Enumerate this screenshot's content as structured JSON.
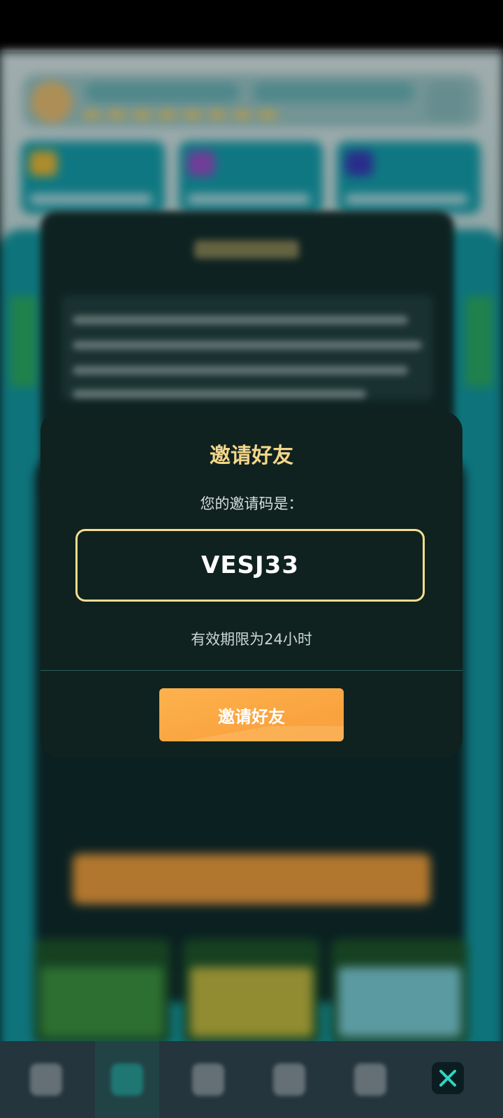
{
  "modal": {
    "title": "邀请好友",
    "subtitle": "您的邀请码是：",
    "invite_code": "VESJ33",
    "validity_text": "有效期限为24小时",
    "invite_button_label": "邀请好友"
  },
  "colors": {
    "title": "#f4d68a",
    "code_border": "#f5dd8d",
    "button": "#f9a33f",
    "modal_bg": "#10221f"
  },
  "bottom_nav": {
    "items": [
      {
        "icon": "pyramid-icon"
      },
      {
        "icon": "shield-icon",
        "active": true
      },
      {
        "icon": "gear-icon"
      },
      {
        "icon": "diamond-icon"
      },
      {
        "icon": "heart-icon"
      }
    ],
    "close_icon": "close-icon"
  }
}
